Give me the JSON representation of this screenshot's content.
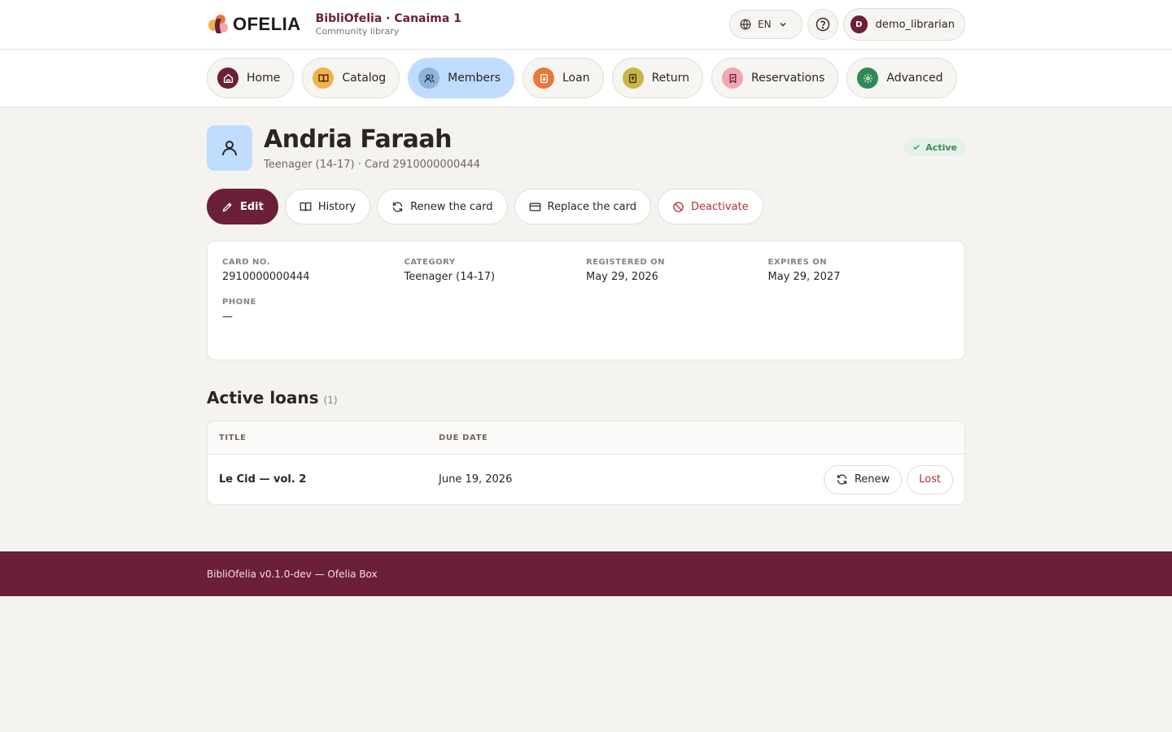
{
  "header": {
    "logo_text": "OFELIA",
    "brand_title": "BibliOfelia · Canaima 1",
    "brand_subtitle": "Community library",
    "language": "EN",
    "user_initial": "D",
    "username": "demo_librarian"
  },
  "nav": {
    "items": [
      {
        "label": "Home",
        "icon": "home-icon",
        "color": "#6b1f38"
      },
      {
        "label": "Catalog",
        "icon": "book-open-icon",
        "color": "#f0b24a"
      },
      {
        "label": "Members",
        "icon": "users-icon",
        "color": "#8fb3d9"
      },
      {
        "label": "Loan",
        "icon": "loan-icon",
        "color": "#e8793b"
      },
      {
        "label": "Return",
        "icon": "return-icon",
        "color": "#c9b54a"
      },
      {
        "label": "Reservations",
        "icon": "bookmark-icon",
        "color": "#f3a6b0"
      },
      {
        "label": "Advanced",
        "icon": "gear-icon",
        "color": "#2f8a55"
      }
    ],
    "active": "Members"
  },
  "member": {
    "name": "Andria Faraah",
    "meta": "Teenager (14-17) · Card 2910000000444",
    "status": "Active"
  },
  "actions": {
    "edit": "Edit",
    "history": "History",
    "renew_card": "Renew the card",
    "replace_card": "Replace the card",
    "deactivate": "Deactivate"
  },
  "details": {
    "card_no_label": "Card no.",
    "card_no": "2910000000444",
    "category_label": "Category",
    "category": "Teenager (14-17)",
    "registered_label": "Registered on",
    "registered": "May 29, 2026",
    "expires_label": "Expires on",
    "expires": "May 29, 2027",
    "phone_label": "Phone",
    "phone": "—"
  },
  "loans": {
    "title": "Active loans",
    "count": "(1)",
    "col_title": "Title",
    "col_due": "Due date",
    "rows": [
      {
        "title": "Le Cid — vol. 2",
        "due": "June 19, 2026",
        "renew": "Renew",
        "lost": "Lost"
      }
    ]
  },
  "footer": {
    "text": "BibliOfelia v0.1.0-dev — Ofelia Box"
  },
  "colors": {
    "brand": "#6b1f38",
    "active_nav": "#bfdcff",
    "success": "#3d8a56",
    "danger": "#b0303a"
  }
}
